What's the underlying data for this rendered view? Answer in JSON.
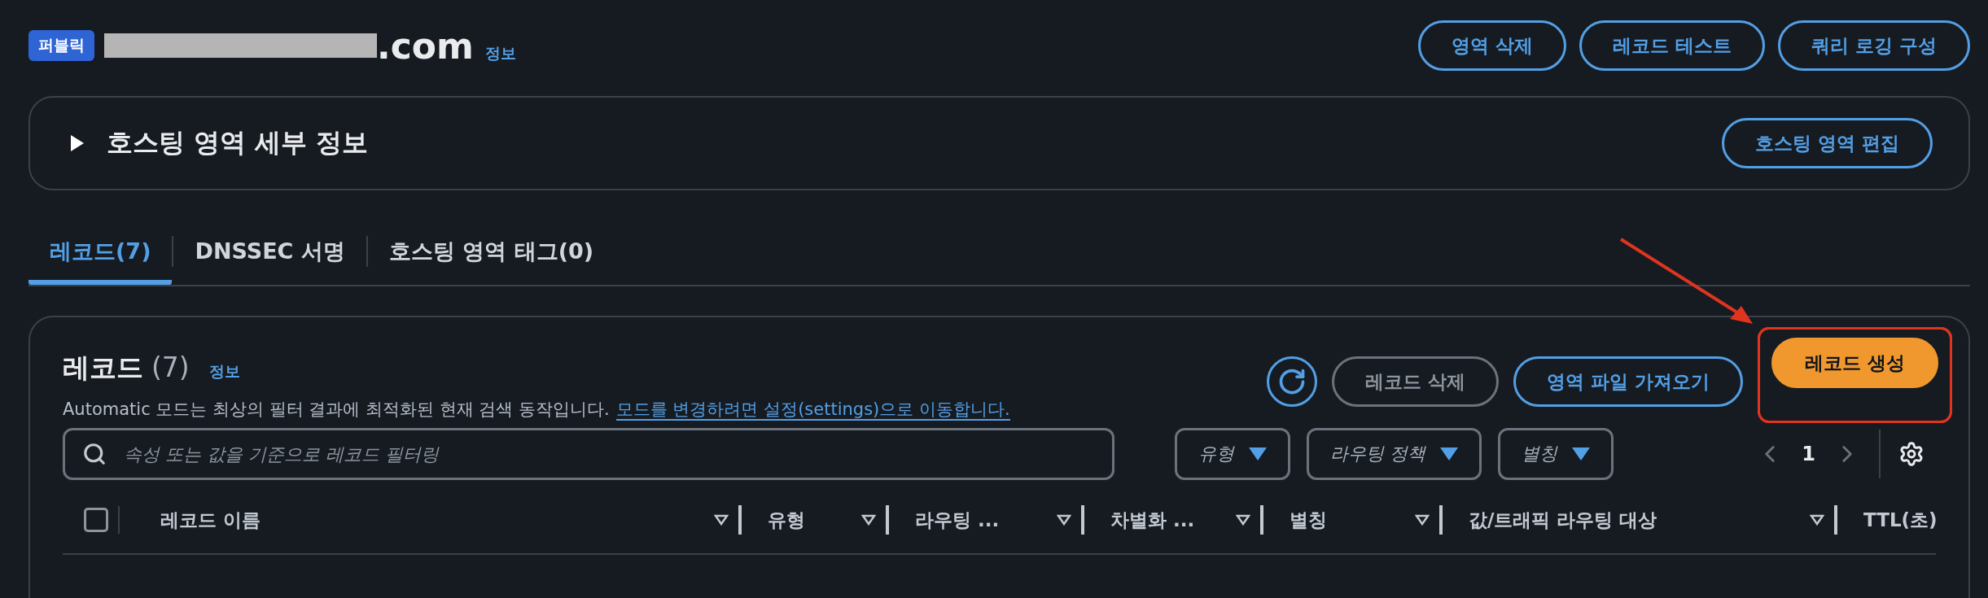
{
  "header": {
    "badge": "퍼블릭",
    "redacted": true,
    "domain": ".com",
    "info": "정보",
    "actions": [
      {
        "label": "영역 삭제"
      },
      {
        "label": "레코드 테스트"
      },
      {
        "label": "쿼리 로깅 구성"
      }
    ]
  },
  "details": {
    "title": "호스팅 영역 세부 정보",
    "expanded": false,
    "edit": "호스팅 영역 편집"
  },
  "tabs": [
    {
      "label": "레코드(7)",
      "selected": true
    },
    {
      "label": "DNSSEC 서명",
      "selected": false
    },
    {
      "label": "호스팅 영역 태그(0)",
      "selected": false
    }
  ],
  "records": {
    "title": "레코드",
    "count": "(7)",
    "info": "정보",
    "description": "Automatic 모드는 최상의 필터 결과에 최적화된 현재 검색 동작입니다.",
    "description_link": "모드를 변경하려면 설정(settings)으로 이동합니다.",
    "buttons": [
      {
        "kind": "normal",
        "label": "레코드 삭제",
        "disabled": true,
        "highlighted": false
      },
      {
        "kind": "normal",
        "label": "영역 파일 가져오기",
        "disabled": false,
        "highlighted": false
      },
      {
        "kind": "primary",
        "label": "레코드 생성",
        "disabled": false,
        "highlighted": true
      }
    ],
    "search": {
      "placeholder": "속성 또는 값을 기준으로 레코드 필터링"
    },
    "filters": [
      {
        "label": "유형"
      },
      {
        "label": "라우팅 정책"
      },
      {
        "label": "별칭"
      }
    ],
    "page": "1",
    "select_all": {
      "checked": false
    },
    "columns": [
      {
        "label": "레코드 이름",
        "sortable": true
      },
      {
        "label": "유형",
        "sortable": true
      },
      {
        "label": "라우팅 ...",
        "sortable": true
      },
      {
        "label": "차별화 ...",
        "sortable": true
      },
      {
        "label": "별칭",
        "sortable": true
      },
      {
        "label": "값/트래픽 라우팅 대상",
        "sortable": true
      },
      {
        "label": "TTL(초)",
        "sortable": false
      }
    ]
  }
}
